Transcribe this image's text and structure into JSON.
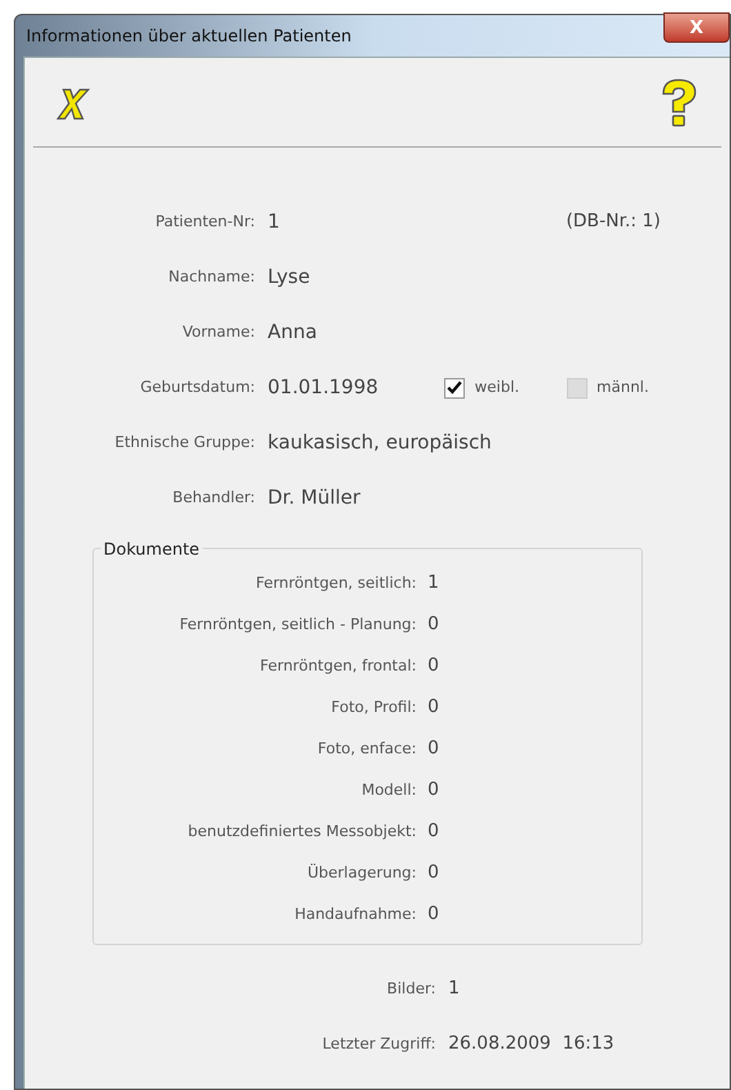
{
  "window": {
    "title": "Informationen über aktuellen Patienten",
    "close_label": "X"
  },
  "patient": {
    "number_label": "Patienten-Nr:",
    "number": "1",
    "db_number": "(DB-Nr.: 1)"
  },
  "fields": [
    {
      "label": "Nachname:",
      "value": "Lyse"
    },
    {
      "label": "Vorname:",
      "value": "Anna"
    }
  ],
  "birth": {
    "label": "Geburtsdatum:",
    "value": "01.01.1998",
    "sexes": [
      {
        "label": "weibl.",
        "checked": true
      },
      {
        "label": "männl.",
        "checked": false
      }
    ]
  },
  "fields2": [
    {
      "label": "Ethnische Gruppe:",
      "value": "kaukasisch, europäisch"
    },
    {
      "label": "Behandler:",
      "value": "Dr. Müller"
    }
  ],
  "documents": {
    "title": "Dokumente",
    "rows": [
      {
        "label": "Fernröntgen, seitlich:",
        "value": "1"
      },
      {
        "label": "Fernröntgen, seitlich - Planung:",
        "value": "0"
      },
      {
        "label": "Fernröntgen, frontal:",
        "value": "0"
      },
      {
        "label": "Foto, Profil:",
        "value": "0"
      },
      {
        "label": "Foto, enface:",
        "value": "0"
      },
      {
        "label": "Modell:",
        "value": "0"
      },
      {
        "label": "benutzdefiniertes Messobjekt:",
        "value": "0"
      },
      {
        "label": "Überlagerung:",
        "value": "0"
      },
      {
        "label": "Handaufnahme:",
        "value": "0"
      }
    ]
  },
  "footer": [
    {
      "label": "Bilder:",
      "value": "1"
    },
    {
      "label": "Letzter Zugriff:",
      "value": "26.08.2009  16:13"
    }
  ]
}
